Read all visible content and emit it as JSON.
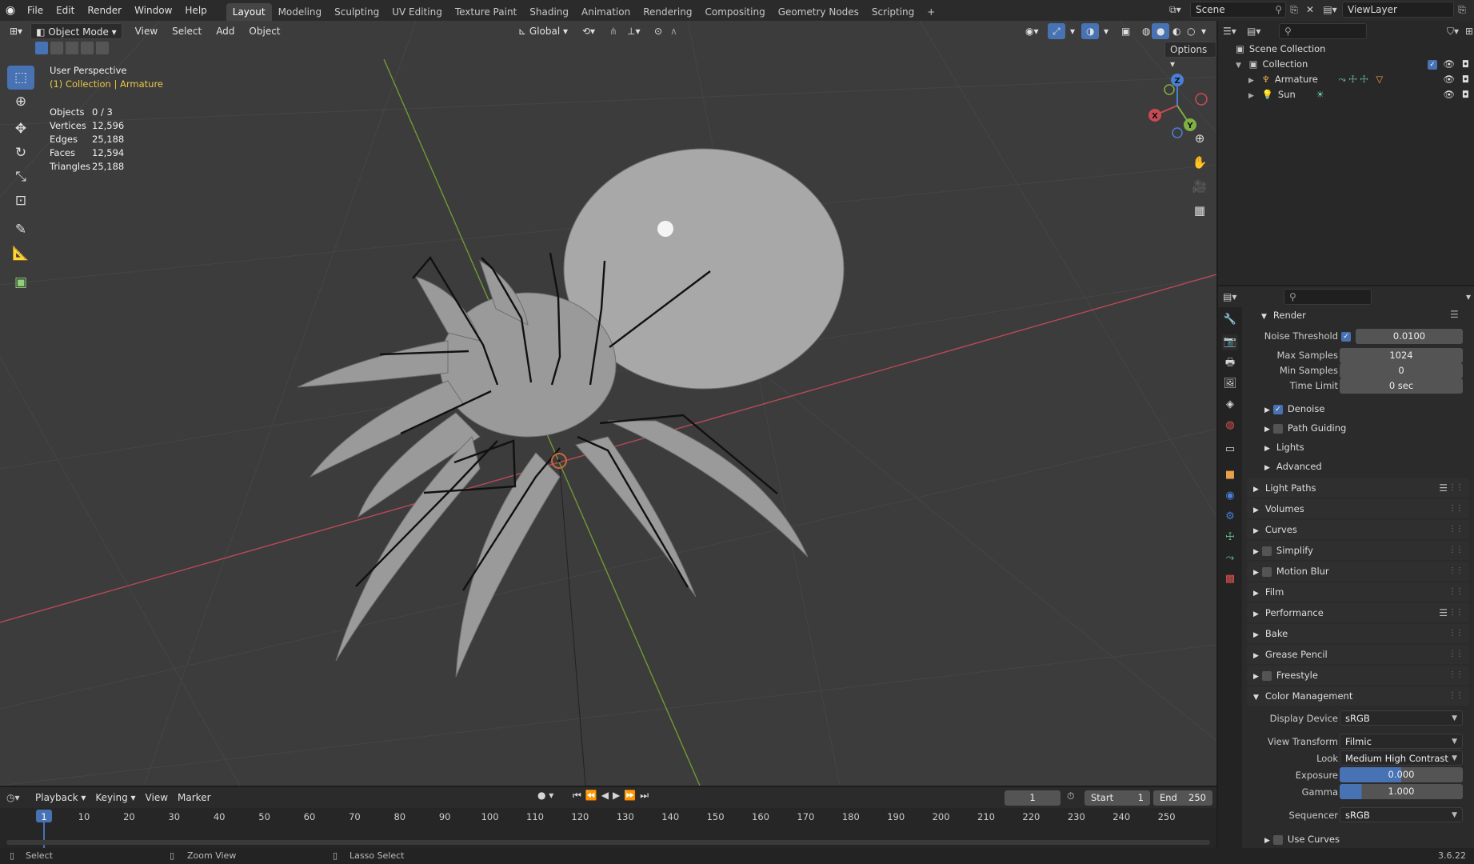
{
  "topbar": {
    "menus": [
      "File",
      "Edit",
      "Render",
      "Window",
      "Help"
    ],
    "workspaces": [
      "Layout",
      "Modeling",
      "Sculpting",
      "UV Editing",
      "Texture Paint",
      "Shading",
      "Animation",
      "Rendering",
      "Compositing",
      "Geometry Nodes",
      "Scripting"
    ],
    "active_workspace": "Layout",
    "add_tab": "+",
    "scene": "Scene",
    "view_layer": "ViewLayer"
  },
  "viewport": {
    "mode": "Object Mode",
    "menus": [
      "View",
      "Select",
      "Add",
      "Object"
    ],
    "orientation": "Global",
    "options": "Options",
    "overlay_title": "User Perspective",
    "overlay_subtitle": "(1) Collection | Armature",
    "stats": [
      {
        "k": "Objects",
        "v": "0 / 3"
      },
      {
        "k": "Vertices",
        "v": "12,596"
      },
      {
        "k": "Edges",
        "v": "25,188"
      },
      {
        "k": "Faces",
        "v": "12,594"
      },
      {
        "k": "Triangles",
        "v": "25,188"
      }
    ],
    "gizmo": {
      "x": "X",
      "y": "Y",
      "z": "Z"
    }
  },
  "outliner": {
    "root": "Scene Collection",
    "collection": "Collection",
    "items": [
      "Armature",
      "Sun"
    ]
  },
  "properties": {
    "render_section": "Render",
    "noise_threshold_label": "Noise Threshold",
    "noise_threshold": "0.0100",
    "max_samples_label": "Max Samples",
    "max_samples": "1024",
    "min_samples_label": "Min Samples",
    "min_samples": "0",
    "time_limit_label": "Time Limit",
    "time_limit": "0 sec",
    "denoise": "Denoise",
    "path_guiding": "Path Guiding",
    "lights": "Lights",
    "advanced": "Advanced",
    "panels": [
      "Light Paths",
      "Volumes",
      "Curves",
      "Simplify",
      "Motion Blur",
      "Film",
      "Performance",
      "Bake",
      "Grease Pencil",
      "Freestyle",
      "Color Management"
    ],
    "display_device_label": "Display Device",
    "display_device": "sRGB",
    "view_transform_label": "View Transform",
    "view_transform": "Filmic",
    "look_label": "Look",
    "look": "Medium High Contrast",
    "exposure_label": "Exposure",
    "exposure": "0.000",
    "gamma_label": "Gamma",
    "gamma": "1.000",
    "sequencer_label": "Sequencer",
    "sequencer": "sRGB",
    "use_curves": "Use Curves"
  },
  "timeline": {
    "menus": [
      "Playback",
      "Keying",
      "View",
      "Marker"
    ],
    "current_frame": "1",
    "start_label": "Start",
    "start": "1",
    "end_label": "End",
    "end": "250",
    "ruler": [
      "1",
      "10",
      "20",
      "30",
      "40",
      "50",
      "60",
      "70",
      "80",
      "90",
      "100",
      "110",
      "120",
      "130",
      "140",
      "150",
      "160",
      "170",
      "180",
      "190",
      "200",
      "210",
      "220",
      "230",
      "240",
      "250"
    ]
  },
  "statusbar": {
    "select": "Select",
    "zoom": "Zoom View",
    "lasso": "Lasso Select",
    "version": "3.6.22"
  },
  "colors": {
    "accent": "#4772b3",
    "viewport_bg": "#3c3c3c",
    "x_axis": "#c0404a",
    "y_axis": "#7aa83a"
  }
}
